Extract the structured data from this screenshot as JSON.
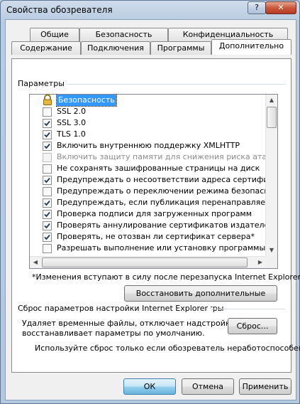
{
  "window": {
    "title": "Свойства обозревателя",
    "help_label": "?",
    "close_label": "✕"
  },
  "tabs": {
    "row1": [
      "Общие",
      "Безопасность",
      "Конфиденциальность"
    ],
    "row2": [
      "Содержание",
      "Подключения",
      "Программы",
      "Дополнительно"
    ],
    "active": "Дополнительно"
  },
  "settings": {
    "group_label": "Параметры",
    "category": "Безопасность",
    "items": [
      {
        "label": "SSL 2.0",
        "checked": false,
        "disabled": false
      },
      {
        "label": "SSL 3.0",
        "checked": true,
        "disabled": false
      },
      {
        "label": "TLS 1.0",
        "checked": true,
        "disabled": false
      },
      {
        "label": "Включить внутреннюю поддержку XMLHTTP",
        "checked": true,
        "disabled": false
      },
      {
        "label": "Включить защиту памяти для снижения риска атаки и",
        "checked": false,
        "disabled": true
      },
      {
        "label": "Не сохранять зашифрованные страницы на диск",
        "checked": false,
        "disabled": false
      },
      {
        "label": "Предупреждать о несоответствии адреса сертификат",
        "checked": true,
        "disabled": false
      },
      {
        "label": "Предупреждать о переключении режима безопасност",
        "checked": false,
        "disabled": false
      },
      {
        "label": "Предупреждать, если публикация перенаправляется",
        "checked": true,
        "disabled": false
      },
      {
        "label": "Проверка подписи для загруженных программ",
        "checked": true,
        "disabled": false
      },
      {
        "label": "Проверять аннулирование сертификатов издателей",
        "checked": true,
        "disabled": false
      },
      {
        "label": "Проверять, не отозван ли сертификат сервера*",
        "checked": true,
        "disabled": false
      },
      {
        "label": "Разрешать выполнение или установку программы, име",
        "checked": false,
        "disabled": false
      }
    ],
    "note": "*Изменения вступают в силу после перезапуска Internet Explorer",
    "restore_button": "Восстановить дополнительные параметры"
  },
  "reset": {
    "group_label": "Сброс параметров настройки Internet Explorer",
    "description_line1": "Удаляет временные файлы, отключает надстройки,",
    "description_line2": "восстанавливает параметры по умолчанию.",
    "reset_button": "Сброс...",
    "warning": "Используйте сброс только если обозреватель неработоспособен."
  },
  "footer": {
    "ok": "ОК",
    "cancel": "Отмена",
    "apply": "Применить"
  }
}
